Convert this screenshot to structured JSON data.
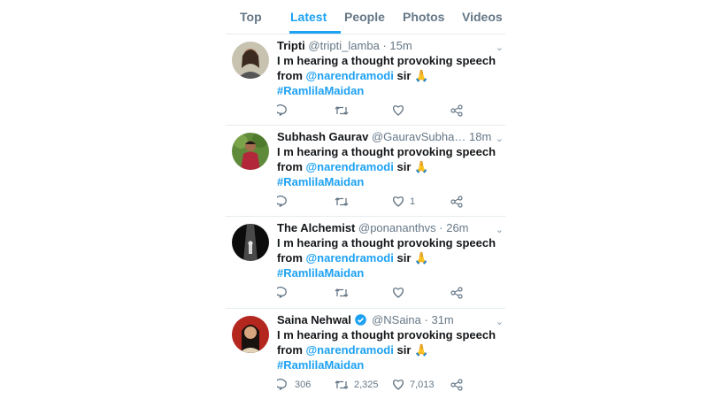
{
  "tabs": [
    {
      "label": "Top"
    },
    {
      "label": "Latest"
    },
    {
      "label": "People"
    },
    {
      "label": "Photos"
    },
    {
      "label": "Videos"
    }
  ],
  "active_tab": "Latest",
  "colors": {
    "accent": "#1da1f2",
    "muted": "#657786",
    "text": "#14171a"
  },
  "tweets": [
    {
      "name": "Tripti",
      "handle": "@tripti_lamba",
      "time": "· 15m",
      "text_1": "I m hearing a thought provoking speech from ",
      "mention": "@narendramodi",
      "text_2": " sir 🙏",
      "hashtag": "#RamlilaMaidan",
      "replies": "",
      "retweets": "",
      "likes": "",
      "verified": false
    },
    {
      "name": "Subhash Gaurav",
      "handle": "@GauravSubha…",
      "time": "18m",
      "text_1": "I m hearing a thought provoking speech from ",
      "mention": "@narendramodi",
      "text_2": " sir 🙏",
      "hashtag": "#RamlilaMaidan",
      "replies": "",
      "retweets": "",
      "likes": "1",
      "verified": false
    },
    {
      "name": "The Alchemist",
      "handle": "@ponananthvs",
      "time": "· 26m",
      "text_1": "I m hearing a thought provoking speech from ",
      "mention": "@narendramodi",
      "text_2": " sir 🙏",
      "hashtag": "#RamlilaMaidan",
      "replies": "",
      "retweets": "",
      "likes": "",
      "verified": false
    },
    {
      "name": "Saina Nehwal",
      "handle": "@NSaina",
      "time": "· 31m",
      "text_1": "I m hearing a thought provoking speech from ",
      "mention": "@narendramodi",
      "text_2": " sir 🙏",
      "hashtag": "#RamlilaMaidan",
      "replies": "306",
      "retweets": "2,325",
      "likes": "7,013",
      "verified": true
    }
  ]
}
